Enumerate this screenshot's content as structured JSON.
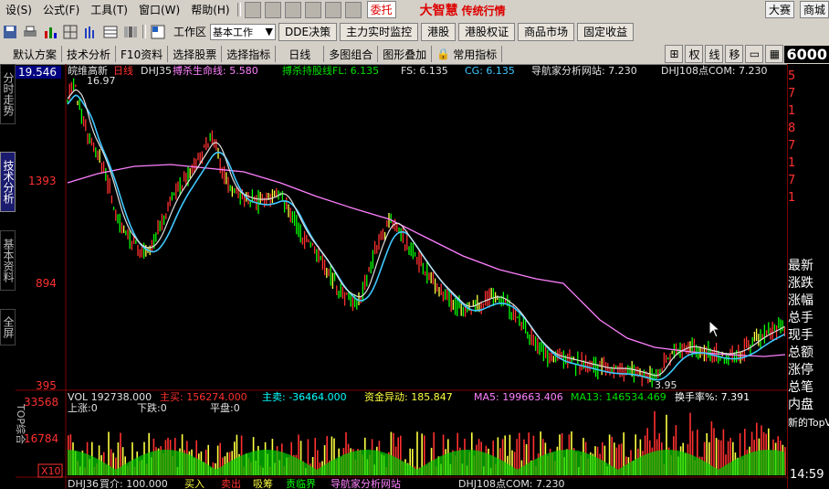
{
  "menu": {
    "items": [
      "设(S)",
      "公式(F)",
      "工具(T)",
      "窗口(W)",
      "帮助(H)"
    ],
    "entrust": "委托",
    "brand": "大智慧",
    "brand_sub": "传统行情",
    "right_buttons": [
      "大赛",
      "商城"
    ]
  },
  "toolbar": {
    "workspace_label": "工作区",
    "workspace_value": "基本工作",
    "tabs": [
      "DDE决策",
      "主力实时监控",
      "港股",
      "港股权证",
      "商品市场",
      "固定收益"
    ]
  },
  "funcbar": {
    "items": [
      "默认方案",
      "技术分析",
      "F10资料",
      "选择股票",
      "选择指标",
      "日线",
      "多图组合",
      "图形叠加",
      "常用指标"
    ],
    "right": [
      "权",
      "线",
      "移"
    ],
    "code": "6000"
  },
  "lefttabs": [
    "分时走势",
    "技术分析",
    "基本资料",
    "全屏"
  ],
  "chart": {
    "stock_name": "皖维高新",
    "period": "日线",
    "indicator": "DHJ35",
    "line1_label": "搏杀生命线: 5.580",
    "line2_label": "搏杀持股线FL: 6.135",
    "fs_label": "FS: 6.135",
    "cg_label": "CG: 6.135",
    "nav_label": "导航家分析网站: 7.230",
    "com_label": "DHJ108点COM: 7.230",
    "high_label": "16.97",
    "low_label": "3.95",
    "y_ticks": [
      "19.546",
      "1393",
      "894",
      "395"
    ],
    "vol_ticks": [
      "33568",
      "16784",
      "X10"
    ],
    "vol_row": {
      "vol": "VOL 192738.000",
      "buy": "主买: 156274.000",
      "sell": "主卖: -36464.000",
      "flow": "资金异动: 185.847",
      "ma5": "MA5: 199663.406",
      "ma13": "MA13: 146534.469",
      "turnover": "换手率%: 7.391"
    },
    "vol_sub": {
      "up": "上涨:0",
      "down": "下跌:0",
      "flat": "平盘:0"
    },
    "bottom_row": [
      "DHJ36",
      "買介: 100.000",
      "买入",
      "卖出",
      "吸筹",
      "责临界",
      "导航家分析网站",
      "DHJ108点COM: 7.230"
    ],
    "left_vertical_label": "TOP综合"
  },
  "rightpanel": {
    "labels": [
      "最新",
      "涨跌",
      "涨幅",
      "总手",
      "现手",
      "总额",
      "涨停",
      "总笔",
      "内盘",
      "新的TopV"
    ],
    "numbers": [
      "5",
      "7",
      "1",
      "8",
      "7",
      "1",
      "7",
      "1"
    ],
    "time": "14:59"
  },
  "colors": {
    "bg": "#000000",
    "price_up": "#ff3030",
    "price_down": "#00ff00",
    "ma_cyan": "#40c8ff",
    "ma_pink": "#ff80ff",
    "ma_white": "#e0e0e0",
    "vol_red": "#ff3030",
    "vol_green": "#00e000"
  }
}
